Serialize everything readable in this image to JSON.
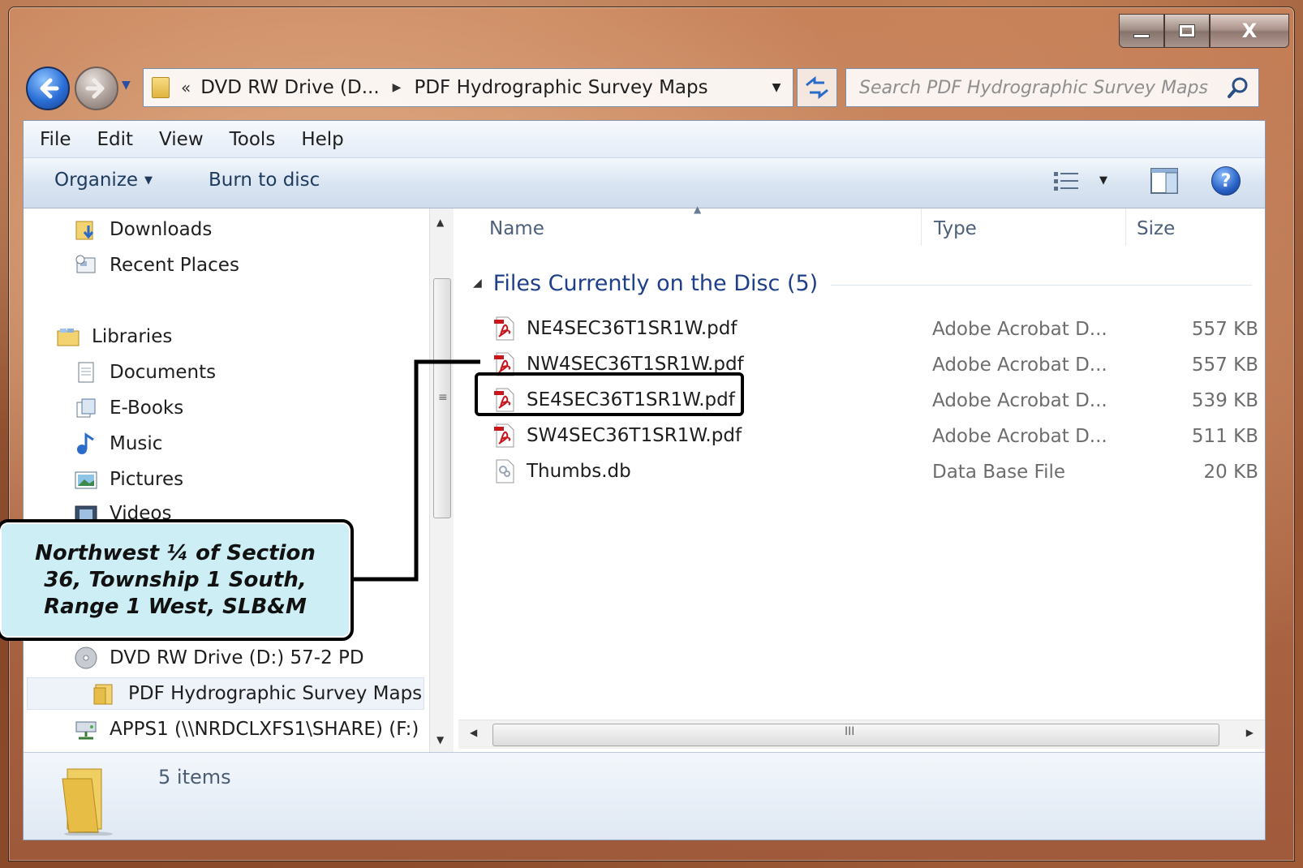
{
  "window": {
    "caption_close": "X"
  },
  "nav": {
    "back_label": "Back",
    "forward_label": "Forward"
  },
  "address": {
    "chevrons": "«",
    "segment1": "DVD RW Drive (D...",
    "segment2": "PDF Hydrographic Survey Maps"
  },
  "search": {
    "placeholder": "Search PDF Hydrographic Survey Maps"
  },
  "menu": [
    "File",
    "Edit",
    "View",
    "Tools",
    "Help"
  ],
  "commands": {
    "organize": "Organize",
    "burn": "Burn to disc",
    "help": "?"
  },
  "navpane": {
    "items": [
      {
        "label": "Downloads",
        "icon": "downloads-icon"
      },
      {
        "label": "Recent Places",
        "icon": "recent-places-icon"
      },
      {
        "label": "Libraries",
        "icon": "libraries-icon"
      },
      {
        "label": "Documents",
        "icon": "documents-icon"
      },
      {
        "label": "E-Books",
        "icon": "ebooks-icon"
      },
      {
        "label": "Music",
        "icon": "music-icon"
      },
      {
        "label": "Pictures",
        "icon": "pictures-icon"
      },
      {
        "label": "Videos",
        "icon": "videos-icon"
      },
      {
        "label": "DVD RW Drive (D:) 57-2 PD",
        "icon": "dvd-drive-icon"
      },
      {
        "label": "PDF Hydrographic Survey Maps",
        "icon": "folder-icon"
      },
      {
        "label": "APPS1 (\\\\NRDCLXFS1\\SHARE) (F:)",
        "icon": "network-drive-icon"
      }
    ]
  },
  "columns": {
    "name": "Name",
    "type": "Type",
    "size": "Size"
  },
  "group": {
    "title": "Files Currently on the Disc (5)"
  },
  "files": [
    {
      "name": "NE4SEC36T1SR1W.pdf",
      "type": "Adobe Acrobat D...",
      "size": "557 KB",
      "icon": "pdf-icon"
    },
    {
      "name": "NW4SEC36T1SR1W.pdf",
      "type": "Adobe Acrobat D...",
      "size": "557 KB",
      "icon": "pdf-icon"
    },
    {
      "name": "SE4SEC36T1SR1W.pdf",
      "type": "Adobe Acrobat D...",
      "size": "539 KB",
      "icon": "pdf-icon"
    },
    {
      "name": "SW4SEC36T1SR1W.pdf",
      "type": "Adobe Acrobat D...",
      "size": "511 KB",
      "icon": "pdf-icon"
    },
    {
      "name": "Thumbs.db",
      "type": "Data Base File",
      "size": "20 KB",
      "icon": "database-file-icon"
    }
  ],
  "details": {
    "count": "5 items"
  },
  "callout": {
    "line1": "Northwest ¼ of Section",
    "line2": "36, Township 1 South,",
    "line3": "Range 1 West, SLB&M"
  },
  "colors": {
    "group_header": "#1e3f8a",
    "callout_fill": "#cdeef5",
    "pdf_red": "#c8161d"
  }
}
